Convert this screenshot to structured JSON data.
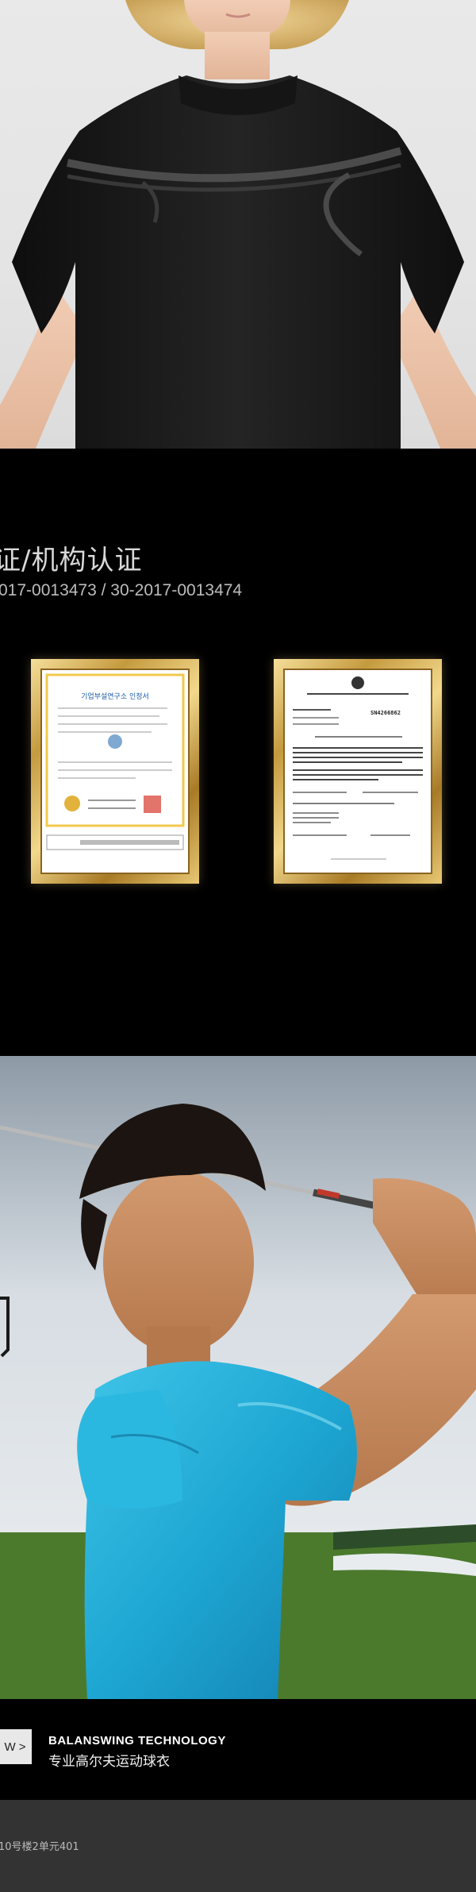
{
  "certification": {
    "title": "证/机构认证",
    "numbers": "017-0013473 / 30-2017-0013474",
    "certificates": [
      {
        "heading": "기업부설연구소 인정서"
      },
      {
        "heading": "SN4266862"
      }
    ]
  },
  "banner": {
    "more_label": "W >",
    "brand_en": "BALANSWING TECHNOLOGY",
    "brand_cn": "专业高尔夫运动球衣"
  },
  "footer": {
    "address": "10号楼2单元401"
  },
  "colors": {
    "shirt_black": "#1a1a1a",
    "shirt_cyan": "#1faed6",
    "frame_gold": "#c59a3e",
    "footer_bg": "#333333"
  }
}
